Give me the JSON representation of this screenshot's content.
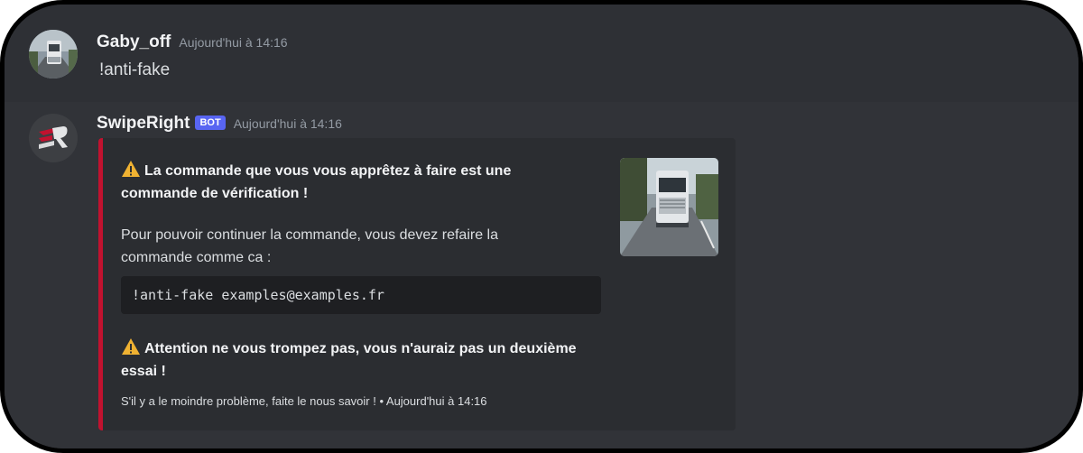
{
  "messages": [
    {
      "username": "Gaby_off",
      "timestamp": "Aujourd'hui à 14:16",
      "content": "!anti-fake",
      "avatar_icon": "truck-avatar"
    },
    {
      "username": "SwipeRight",
      "badge": "BOT",
      "timestamp": "Aujourd'hui à 14:16",
      "avatar_icon": "swiperight-logo",
      "embed": {
        "accent_color": "#c1122f",
        "title": "La commande que vous vous apprêtez à faire est une commande de vérification !",
        "description": "Pour pouvoir continuer la commande, vous devez refaire la commande comme ca :",
        "code": "!anti-fake examples@examples.fr",
        "warning": "Attention ne vous trompez pas, vous n'auraiz pas un deuxième essai !",
        "footer": "S'il y a le moindre problème, faite le nous savoir ! • Aujourd'hui à 14:16",
        "thumbnail_icon": "truck-thumbnail",
        "warn_icon": "warning-icon"
      }
    }
  ],
  "colors": {
    "background": "#313338",
    "hover_background": "#2e3035",
    "bot_badge": "#5865f2",
    "embed_background": "#2b2d31"
  }
}
